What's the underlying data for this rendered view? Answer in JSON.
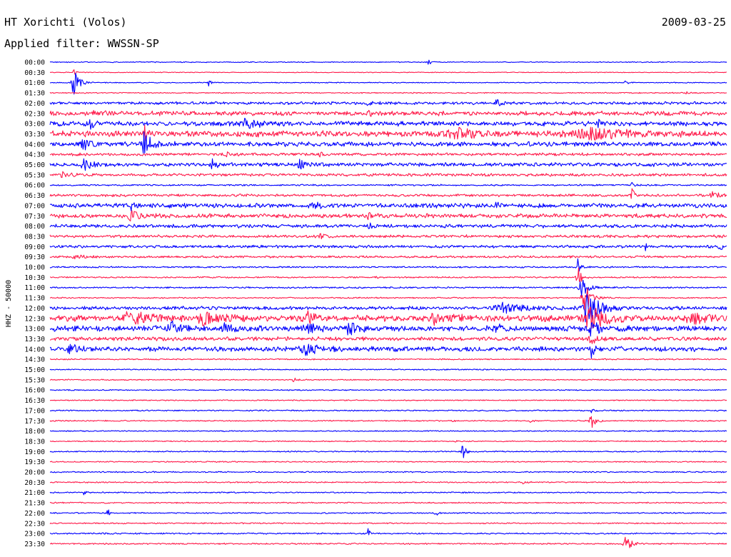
{
  "header": {
    "station": "HT Xorichti (Volos)",
    "date": "2009-03-25",
    "filter": "Applied filter: WWSSN-SP"
  },
  "chart_data": {
    "type": "line",
    "title": "HT Xorichti (Volos)",
    "subtitle": "Applied filter: WWSSN-SP",
    "ylabel": "HHZ - 50000",
    "xlabel": "",
    "tick_labels": [
      "00:00",
      "00:30",
      "01:00",
      "01:30",
      "02:00",
      "02:30",
      "03:00",
      "03:30",
      "04:00",
      "04:30",
      "05:00",
      "05:30",
      "06:00",
      "06:30",
      "07:00",
      "07:30",
      "08:00",
      "08:30",
      "09:00",
      "09:30",
      "10:00",
      "10:30",
      "11:00",
      "11:30",
      "12:00",
      "12:30",
      "13:00",
      "13:30",
      "14:00",
      "14:30",
      "15:00",
      "15:30",
      "16:00",
      "16:30",
      "17:00",
      "17:30",
      "18:00",
      "18:30",
      "19:00",
      "19:30",
      "20:00",
      "20:30",
      "21:00",
      "21:30",
      "22:00",
      "22:30",
      "23:00",
      "23:30"
    ],
    "trace_colors": [
      "#0000ff",
      "#ff1a4a"
    ],
    "series": [
      {
        "label": "00:00",
        "noise": 0.6,
        "events": [
          {
            "x": 0.56,
            "amp": 4,
            "width": 0.004
          }
        ]
      },
      {
        "label": "00:30",
        "noise": 0.5,
        "events": [
          {
            "x": 0.035,
            "amp": 8,
            "width": 0.002
          }
        ]
      },
      {
        "label": "01:00",
        "noise": 0.6,
        "events": [
          {
            "x": 0.035,
            "amp": 22,
            "width": 0.006
          },
          {
            "x": 0.235,
            "amp": 5,
            "width": 0.003
          },
          {
            "x": 0.85,
            "amp": 5,
            "width": 0.003
          }
        ]
      },
      {
        "label": "01:30",
        "noise": 0.7,
        "events": [
          {
            "x": 0.94,
            "amp": 3,
            "width": 0.003
          }
        ]
      },
      {
        "label": "02:00",
        "noise": 1.8,
        "events": [
          {
            "x": 0.47,
            "amp": 5,
            "width": 0.004
          },
          {
            "x": 0.66,
            "amp": 5,
            "width": 0.006
          }
        ]
      },
      {
        "label": "02:30",
        "noise": 2.8,
        "events": [
          {
            "x": 0.47,
            "amp": 9,
            "width": 0.003
          },
          {
            "x": 0.07,
            "amp": 4,
            "width": 0.01
          }
        ]
      },
      {
        "label": "03:00",
        "noise": 3.0,
        "events": [
          {
            "x": 0.06,
            "amp": 7,
            "width": 0.004
          },
          {
            "x": 0.29,
            "amp": 10,
            "width": 0.006
          },
          {
            "x": 0.31,
            "amp": 6,
            "width": 0.004
          },
          {
            "x": 0.81,
            "amp": 7,
            "width": 0.004
          }
        ]
      },
      {
        "label": "03:30",
        "noise": 3.8,
        "events": [
          {
            "x": 0.14,
            "amp": 9,
            "width": 0.004
          },
          {
            "x": 0.6,
            "amp": 6,
            "width": 0.03
          },
          {
            "x": 0.8,
            "amp": 7,
            "width": 0.04
          }
        ]
      },
      {
        "label": "04:00",
        "noise": 3.0,
        "events": [
          {
            "x": 0.14,
            "amp": 20,
            "width": 0.008
          },
          {
            "x": 0.05,
            "amp": 6,
            "width": 0.01
          }
        ]
      },
      {
        "label": "04:30",
        "noise": 1.8,
        "events": [
          {
            "x": 0.26,
            "amp": 5,
            "width": 0.003
          },
          {
            "x": 0.4,
            "amp": 4,
            "width": 0.003
          }
        ]
      },
      {
        "label": "05:00",
        "noise": 2.4,
        "events": [
          {
            "x": 0.05,
            "amp": 7,
            "width": 0.01
          },
          {
            "x": 0.24,
            "amp": 7,
            "width": 0.005
          },
          {
            "x": 0.37,
            "amp": 6,
            "width": 0.006
          }
        ]
      },
      {
        "label": "05:30",
        "noise": 1.8,
        "events": [
          {
            "x": 0.02,
            "amp": 4,
            "width": 0.01
          }
        ]
      },
      {
        "label": "06:00",
        "noise": 1.0,
        "events": [
          {
            "x": 0.86,
            "amp": 4,
            "width": 0.003
          }
        ]
      },
      {
        "label": "06:30",
        "noise": 1.6,
        "events": [
          {
            "x": 0.86,
            "amp": 9,
            "width": 0.003
          },
          {
            "x": 0.98,
            "amp": 4,
            "width": 0.008
          }
        ]
      },
      {
        "label": "07:00",
        "noise": 2.8,
        "events": [
          {
            "x": 0.12,
            "amp": 7,
            "width": 0.004
          },
          {
            "x": 0.39,
            "amp": 6,
            "width": 0.005
          },
          {
            "x": 0.56,
            "amp": 7,
            "width": 0.004
          },
          {
            "x": 0.66,
            "amp": 6,
            "width": 0.004
          }
        ]
      },
      {
        "label": "07:30",
        "noise": 2.6,
        "events": [
          {
            "x": 0.12,
            "amp": 7,
            "width": 0.008
          },
          {
            "x": 0.47,
            "amp": 5,
            "width": 0.004
          }
        ]
      },
      {
        "label": "08:00",
        "noise": 2.2,
        "events": [
          {
            "x": 0.47,
            "amp": 5,
            "width": 0.004
          }
        ]
      },
      {
        "label": "08:30",
        "noise": 1.8,
        "events": [
          {
            "x": 0.4,
            "amp": 4,
            "width": 0.004
          }
        ]
      },
      {
        "label": "09:00",
        "noise": 1.8,
        "events": [
          {
            "x": 0.88,
            "amp": 5,
            "width": 0.003
          },
          {
            "x": 0.99,
            "amp": 5,
            "width": 0.003
          }
        ]
      },
      {
        "label": "09:30",
        "noise": 1.4,
        "events": [
          {
            "x": 0.04,
            "amp": 3,
            "width": 0.01
          }
        ]
      },
      {
        "label": "10:00",
        "noise": 1.0,
        "events": [
          {
            "x": 0.78,
            "amp": 14,
            "width": 0.003
          }
        ]
      },
      {
        "label": "10:30",
        "noise": 0.9,
        "events": [
          {
            "x": 0.78,
            "amp": 18,
            "width": 0.004
          },
          {
            "x": 0.48,
            "amp": 3,
            "width": 0.003
          }
        ]
      },
      {
        "label": "11:00",
        "noise": 1.0,
        "events": [
          {
            "x": 0.785,
            "amp": 25,
            "width": 0.006
          }
        ]
      },
      {
        "label": "11:30",
        "noise": 0.8,
        "events": [
          {
            "x": 0.79,
            "amp": 22,
            "width": 0.008
          }
        ]
      },
      {
        "label": "12:00",
        "noise": 2.2,
        "events": [
          {
            "x": 0.795,
            "amp": 26,
            "width": 0.014
          },
          {
            "x": 0.67,
            "amp": 6,
            "width": 0.03
          }
        ]
      },
      {
        "label": "12:30",
        "noise": 3.8,
        "events": [
          {
            "x": 0.8,
            "amp": 14,
            "width": 0.02
          },
          {
            "x": 0.12,
            "amp": 9,
            "width": 0.02
          },
          {
            "x": 0.23,
            "amp": 9,
            "width": 0.02
          },
          {
            "x": 0.38,
            "amp": 9,
            "width": 0.01
          },
          {
            "x": 0.57,
            "amp": 8,
            "width": 0.02
          },
          {
            "x": 0.95,
            "amp": 8,
            "width": 0.02
          }
        ]
      },
      {
        "label": "13:00",
        "noise": 3.6,
        "events": [
          {
            "x": 0.8,
            "amp": 12,
            "width": 0.01
          },
          {
            "x": 0.18,
            "amp": 8,
            "width": 0.01
          },
          {
            "x": 0.26,
            "amp": 8,
            "width": 0.01
          },
          {
            "x": 0.38,
            "amp": 8,
            "width": 0.01
          },
          {
            "x": 0.44,
            "amp": 8,
            "width": 0.01
          },
          {
            "x": 0.66,
            "amp": 6,
            "width": 0.006
          }
        ]
      },
      {
        "label": "13:30",
        "noise": 2.4,
        "events": [
          {
            "x": 0.8,
            "amp": 10,
            "width": 0.006
          }
        ]
      },
      {
        "label": "14:00",
        "noise": 3.0,
        "events": [
          {
            "x": 0.8,
            "amp": 12,
            "width": 0.004
          },
          {
            "x": 0.38,
            "amp": 9,
            "width": 0.015
          },
          {
            "x": 0.03,
            "amp": 5,
            "width": 0.01
          }
        ]
      },
      {
        "label": "14:30",
        "noise": 0.8,
        "events": []
      },
      {
        "label": "15:00",
        "noise": 0.8,
        "events": []
      },
      {
        "label": "15:30",
        "noise": 0.7,
        "events": [
          {
            "x": 0.36,
            "amp": 3,
            "width": 0.004
          }
        ]
      },
      {
        "label": "16:00",
        "noise": 0.7,
        "events": []
      },
      {
        "label": "16:30",
        "noise": 0.7,
        "events": []
      },
      {
        "label": "17:00",
        "noise": 0.8,
        "events": [
          {
            "x": 0.8,
            "amp": 3,
            "width": 0.003
          }
        ]
      },
      {
        "label": "17:30",
        "noise": 0.8,
        "events": [
          {
            "x": 0.8,
            "amp": 12,
            "width": 0.005
          },
          {
            "x": 0.71,
            "amp": 4,
            "width": 0.003
          },
          {
            "x": 0.59,
            "amp": 3,
            "width": 0.003
          }
        ]
      },
      {
        "label": "18:00",
        "noise": 0.7,
        "events": []
      },
      {
        "label": "18:30",
        "noise": 0.7,
        "events": [
          {
            "x": 0.6,
            "amp": 3,
            "width": 0.003
          }
        ]
      },
      {
        "label": "19:00",
        "noise": 0.8,
        "events": [
          {
            "x": 0.61,
            "amp": 10,
            "width": 0.004
          }
        ]
      },
      {
        "label": "19:30",
        "noise": 0.7,
        "events": []
      },
      {
        "label": "20:00",
        "noise": 0.8,
        "events": []
      },
      {
        "label": "20:30",
        "noise": 0.8,
        "events": [
          {
            "x": 0.7,
            "amp": 3,
            "width": 0.004
          }
        ]
      },
      {
        "label": "21:00",
        "noise": 0.8,
        "events": [
          {
            "x": 0.05,
            "amp": 3,
            "width": 0.003
          }
        ]
      },
      {
        "label": "21:30",
        "noise": 0.8,
        "events": []
      },
      {
        "label": "22:00",
        "noise": 0.8,
        "events": [
          {
            "x": 0.085,
            "amp": 9,
            "width": 0.002
          },
          {
            "x": 0.57,
            "amp": 5,
            "width": 0.003
          }
        ]
      },
      {
        "label": "22:30",
        "noise": 0.8,
        "events": []
      },
      {
        "label": "23:00",
        "noise": 0.9,
        "events": [
          {
            "x": 0.47,
            "amp": 8,
            "width": 0.002
          }
        ]
      },
      {
        "label": "23:30",
        "noise": 0.9,
        "events": [
          {
            "x": 0.85,
            "amp": 16,
            "width": 0.006
          }
        ]
      }
    ]
  }
}
